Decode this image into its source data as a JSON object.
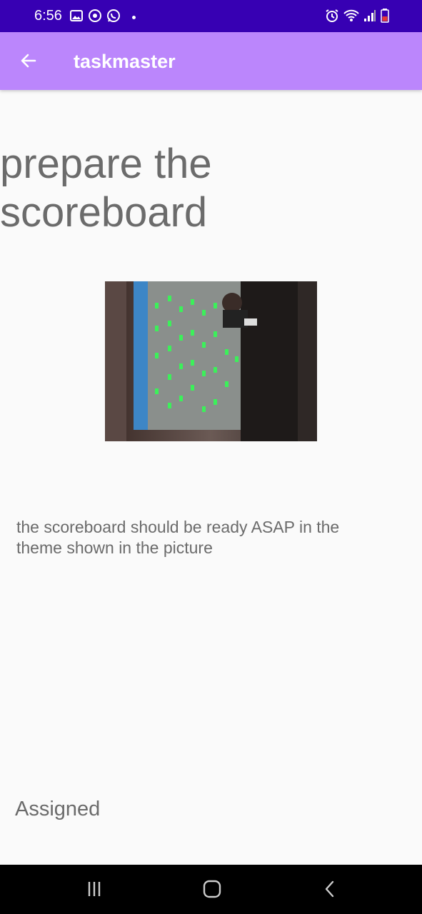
{
  "status_bar": {
    "time": "6:56",
    "left_icons": [
      "gallery-icon",
      "sync-icon",
      "whatsapp-icon",
      "notification-dot"
    ],
    "right_icons": [
      "alarm-icon",
      "wifi-icon",
      "signal-icon",
      "battery-icon"
    ],
    "background": "#3700b3"
  },
  "app_bar": {
    "title": "taskmaster",
    "back_icon": "arrow-left-icon",
    "background": "#bb86fc"
  },
  "task": {
    "title": "prepare the scoreboard",
    "body": "the scoreboard should be ready ASAP in the theme shown in the picture",
    "state": "Assigned"
  },
  "nav_bar": {
    "icons": [
      "recents-icon",
      "home-icon",
      "back-icon"
    ]
  }
}
